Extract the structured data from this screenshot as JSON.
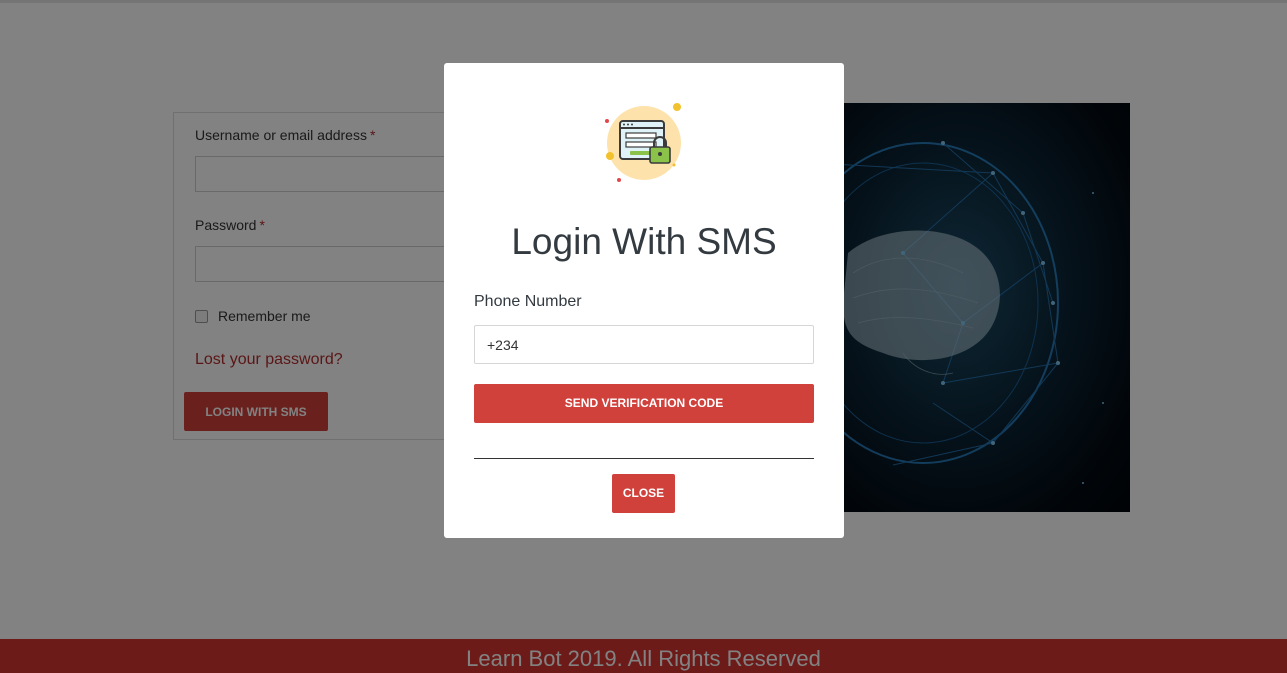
{
  "login_form": {
    "username_label": "Username or email address",
    "password_label": "Password",
    "required_mark": "*",
    "username_value": "",
    "password_value": "",
    "remember_label": "Remember me",
    "lost_password_link": "Lost your password?",
    "sms_button_label": "LOGIN WITH SMS"
  },
  "modal": {
    "icon": "login-lock-icon",
    "title": "Login With SMS",
    "phone_label": "Phone Number",
    "phone_value": "+234",
    "send_button_label": "SEND VERIFICATION CODE",
    "close_button_label": "CLOSE"
  },
  "hero_image": {
    "icon": "brain-network-image"
  },
  "footer": {
    "text": "Learn Bot 2019. All Rights Reserved"
  },
  "colors": {
    "accent": "#d0413c",
    "footer_bg": "#d63631",
    "link": "#b32d2e"
  }
}
